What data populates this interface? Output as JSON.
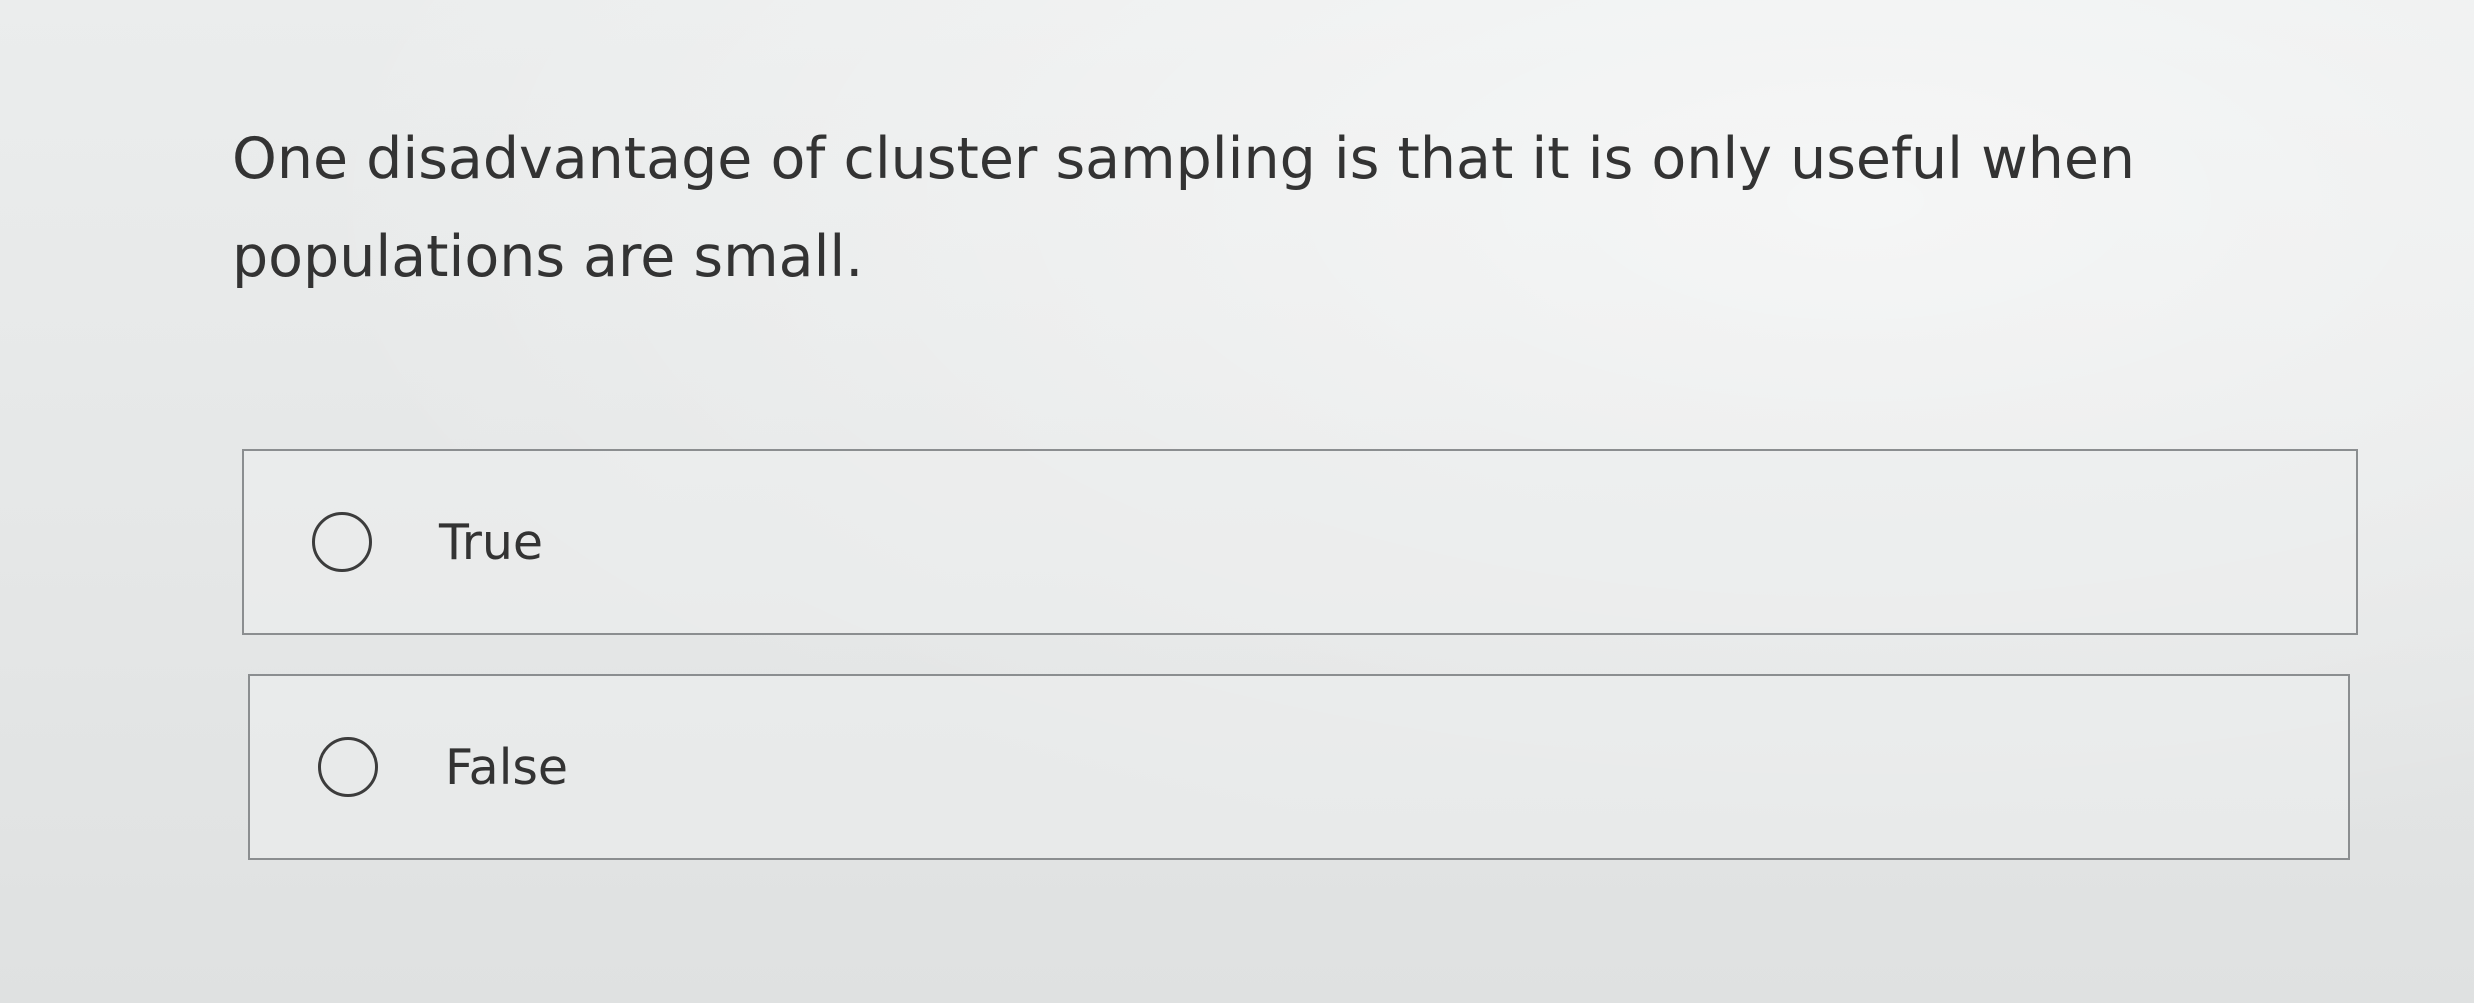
{
  "question": {
    "text": "One disadvantage of cluster sampling is that it is only useful when populations are small."
  },
  "options": [
    {
      "label": "True",
      "selected": false
    },
    {
      "label": "False",
      "selected": false
    }
  ]
}
